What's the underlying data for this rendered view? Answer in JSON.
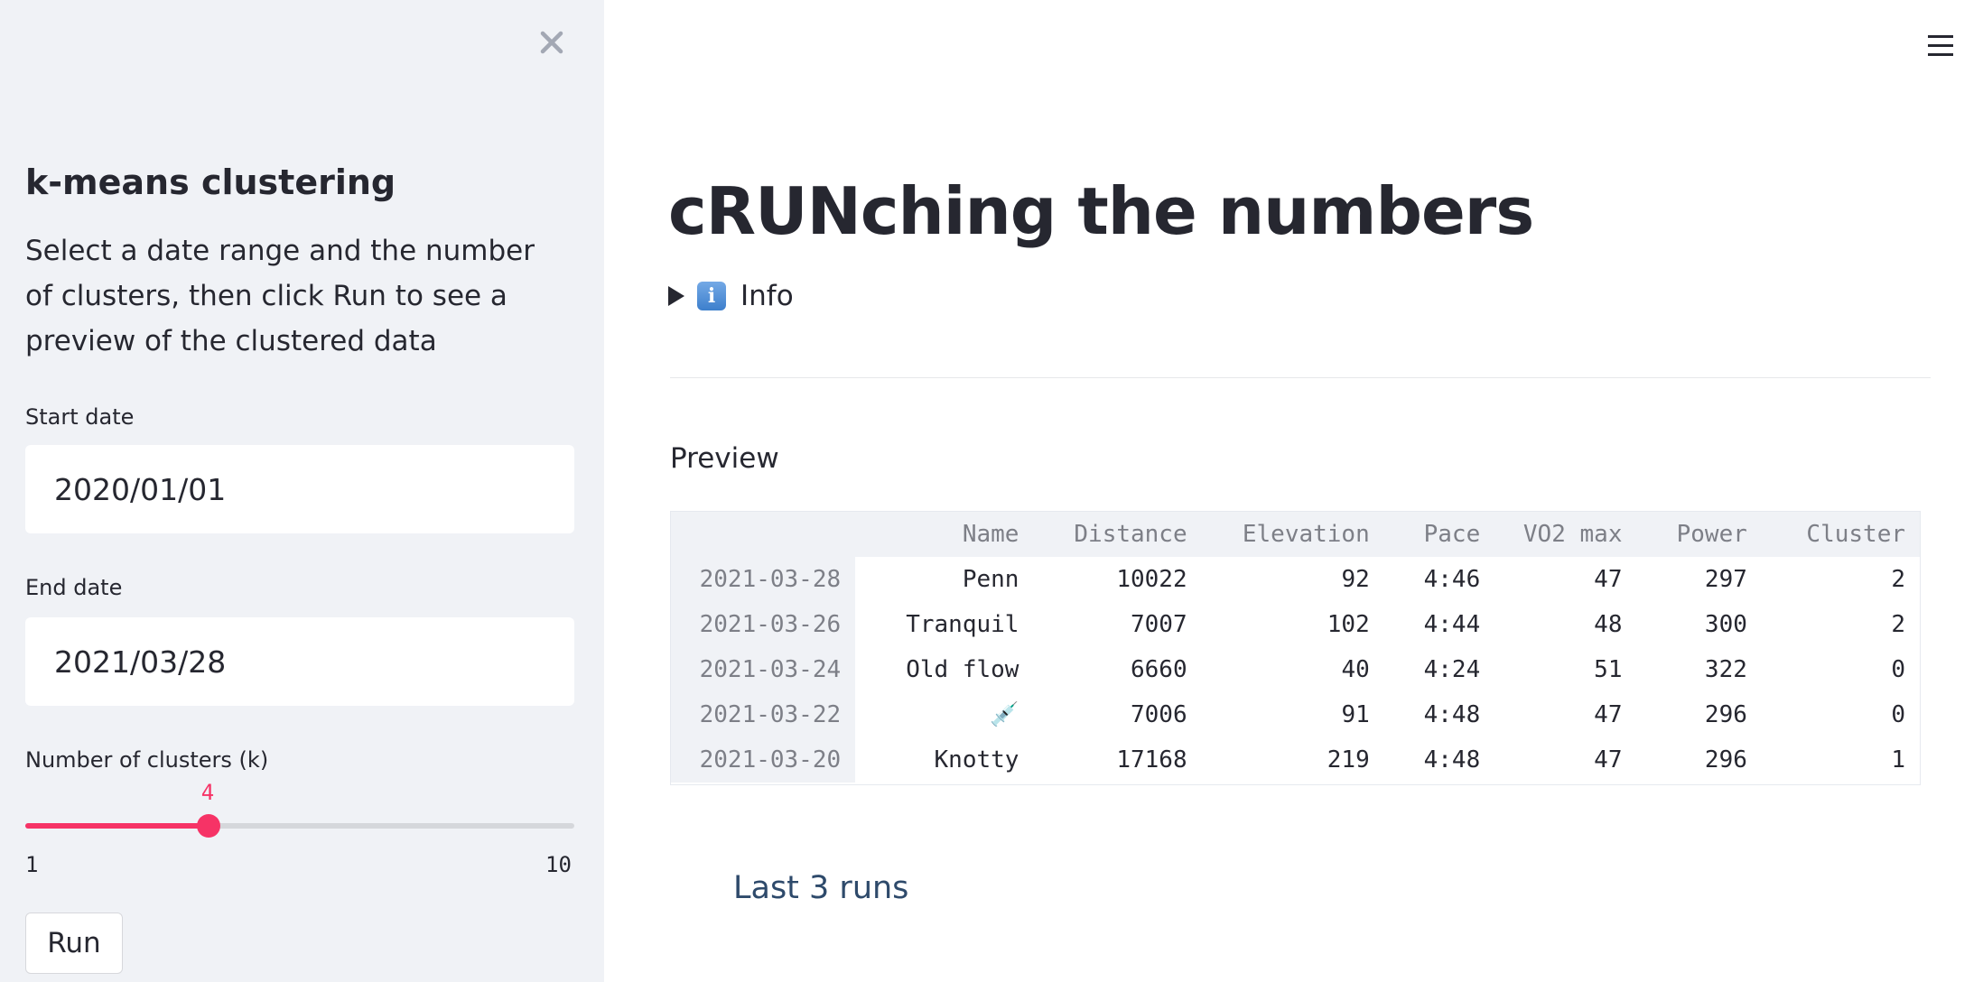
{
  "sidebar": {
    "title": "k-means clustering",
    "description": "Select a date range and the number of clusters, then click Run to see a preview of the clustered data",
    "start_date": {
      "label": "Start date",
      "value": "2020/01/01"
    },
    "end_date": {
      "label": "End date",
      "value": "2021/03/28"
    },
    "clusters": {
      "label": "Number of clusters (k)",
      "value": 4,
      "value_text": "4",
      "min": "1",
      "max": "10"
    },
    "run_label": "Run",
    "close_icon": "close-icon"
  },
  "main": {
    "title": "cRUNching the numbers",
    "expander": {
      "icon": "info-icon",
      "icon_glyph": "i",
      "label": "Info"
    },
    "preview_label": "Preview",
    "table": {
      "columns": [
        "Name",
        "Distance",
        "Elevation",
        "Pace",
        "VO2 max",
        "Power",
        "Cluster"
      ],
      "rows": [
        {
          "date": "2021-03-28",
          "cells": [
            "Penn",
            "10022",
            "92",
            "4:46",
            "47",
            "297",
            "2"
          ]
        },
        {
          "date": "2021-03-26",
          "cells": [
            "Tranquil",
            "7007",
            "102",
            "4:44",
            "48",
            "300",
            "2"
          ]
        },
        {
          "date": "2021-03-24",
          "cells": [
            "Old flow",
            "6660",
            "40",
            "4:24",
            "51",
            "322",
            "0"
          ]
        },
        {
          "date": "2021-03-22",
          "cells": [
            "💉",
            "7006",
            "91",
            "4:48",
            "47",
            "296",
            "0"
          ]
        },
        {
          "date": "2021-03-20",
          "cells": [
            "Knotty",
            "17168",
            "219",
            "4:48",
            "47",
            "296",
            "1"
          ]
        }
      ]
    },
    "last_runs_label": "Last 3 runs",
    "menu_icon": "hamburger-menu-icon"
  },
  "colors": {
    "accent": "#f63366",
    "sidebar_bg": "#f0f2f6",
    "text": "#262730"
  }
}
